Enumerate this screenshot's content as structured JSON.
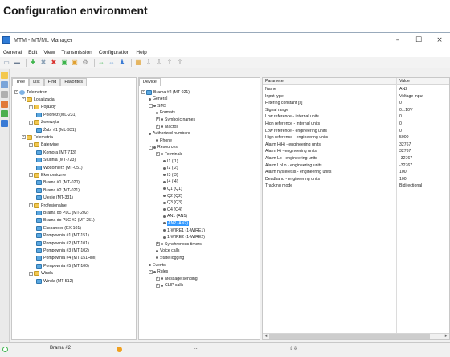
{
  "heading": "Configuration environment",
  "window": {
    "title": "MTM - MT/ML Manager",
    "controls": {
      "minimize": "–",
      "maximize": "☐",
      "close": "×"
    }
  },
  "menu": [
    "General",
    "Edit",
    "View",
    "Transmission",
    "Configuration",
    "Help"
  ],
  "toolbar_icons": [
    "open-icon",
    "save-icon",
    "connect-icon",
    "disconnect-icon",
    "delete-icon",
    "read-icon",
    "write-icon",
    "settings-icon",
    "link-icon",
    "unlink-icon",
    "user-icon",
    "monitor-icon",
    "upload-icon",
    "download-icon",
    "up-icon",
    "top-icon"
  ],
  "left_tabs": [
    "Tree",
    "List",
    "Find",
    "Favorites"
  ],
  "left_tree": [
    {
      "label": "Telemetron",
      "level": 0,
      "icon": "globe",
      "exp": "-"
    },
    {
      "label": "Lokalizacja",
      "level": 1,
      "icon": "folder",
      "exp": "-"
    },
    {
      "label": "Pojazdy",
      "level": 2,
      "icon": "folder",
      "exp": "-"
    },
    {
      "label": "Polonez (ML-231)",
      "level": 3,
      "icon": "dev",
      "exp": ""
    },
    {
      "label": "Zwierzęta",
      "level": 2,
      "icon": "folder",
      "exp": "-"
    },
    {
      "label": "Żubr #1 (ML-931)",
      "level": 3,
      "icon": "dev",
      "exp": ""
    },
    {
      "label": "Telemetria",
      "level": 1,
      "icon": "folder",
      "exp": "-"
    },
    {
      "label": "Bateryjne",
      "level": 2,
      "icon": "folder",
      "exp": "-"
    },
    {
      "label": "Komora (MT-713)",
      "level": 3,
      "icon": "dev",
      "exp": ""
    },
    {
      "label": "Studnia (MT-723)",
      "level": 3,
      "icon": "dev",
      "exp": ""
    },
    {
      "label": "Wodomierz (MT-051)",
      "level": 3,
      "icon": "dev",
      "exp": ""
    },
    {
      "label": "Ekonomiczne",
      "level": 2,
      "icon": "folder",
      "exp": "-"
    },
    {
      "label": "Brama #1 (MT-020)",
      "level": 3,
      "icon": "dev",
      "exp": ""
    },
    {
      "label": "Brama #2 (MT-021)",
      "level": 3,
      "icon": "dev",
      "exp": ""
    },
    {
      "label": "Ujęcie (MT-331)",
      "level": 3,
      "icon": "dev",
      "exp": ""
    },
    {
      "label": "Profesjonalne",
      "level": 2,
      "icon": "folder",
      "exp": "-"
    },
    {
      "label": "Brama do PLC (MT-202)",
      "level": 3,
      "icon": "dev",
      "exp": ""
    },
    {
      "label": "Brama do PLC #2 (MT-251)",
      "level": 3,
      "icon": "dev",
      "exp": ""
    },
    {
      "label": "Ekspander (EX-101)",
      "level": 3,
      "icon": "dev",
      "exp": ""
    },
    {
      "label": "Pompownia #1 (MT-151)",
      "level": 3,
      "icon": "dev",
      "exp": ""
    },
    {
      "label": "Pompownia #2 (MT-101)",
      "level": 3,
      "icon": "dev",
      "exp": ""
    },
    {
      "label": "Pompownia #3 (MT-102)",
      "level": 3,
      "icon": "dev",
      "exp": ""
    },
    {
      "label": "Pompownia #4 (MT-151HMI)",
      "level": 3,
      "icon": "dev",
      "exp": ""
    },
    {
      "label": "Pompownia #5 (MT-100)",
      "level": 3,
      "icon": "dev",
      "exp": ""
    },
    {
      "label": "Winda",
      "level": 2,
      "icon": "folder",
      "exp": "-"
    },
    {
      "label": "Winda (MT-512)",
      "level": 3,
      "icon": "dev",
      "exp": ""
    }
  ],
  "device_tab": "Device",
  "device_tree": [
    {
      "label": "Brama #2 (MT-021)",
      "level": 0,
      "icon": "dev",
      "exp": "-"
    },
    {
      "label": "General",
      "level": 1,
      "icon": "dot",
      "exp": ""
    },
    {
      "label": "SMS",
      "level": 1,
      "icon": "dot",
      "exp": "-"
    },
    {
      "label": "Formats",
      "level": 2,
      "icon": "dot",
      "exp": ""
    },
    {
      "label": "Symbolic names",
      "level": 2,
      "icon": "dot",
      "exp": "+"
    },
    {
      "label": "Macros",
      "level": 2,
      "icon": "dot",
      "exp": "+"
    },
    {
      "label": "Authorized numbers",
      "level": 1,
      "icon": "dot",
      "exp": ""
    },
    {
      "label": "Phone",
      "level": 2,
      "icon": "dot",
      "exp": ""
    },
    {
      "label": "Resources",
      "level": 1,
      "icon": "dot",
      "exp": "-"
    },
    {
      "label": "Terminals",
      "level": 2,
      "icon": "dot",
      "exp": "-"
    },
    {
      "label": "I1 (I1)",
      "level": 3,
      "icon": "dot",
      "exp": ""
    },
    {
      "label": "I2 (I2)",
      "level": 3,
      "icon": "dot",
      "exp": ""
    },
    {
      "label": "I3 (I3)",
      "level": 3,
      "icon": "dot",
      "exp": ""
    },
    {
      "label": "I4 (I4)",
      "level": 3,
      "icon": "dot",
      "exp": ""
    },
    {
      "label": "Q1 (Q1)",
      "level": 3,
      "icon": "dot",
      "exp": ""
    },
    {
      "label": "Q2 (Q2)",
      "level": 3,
      "icon": "dot",
      "exp": ""
    },
    {
      "label": "Q3 (Q3)",
      "level": 3,
      "icon": "dot",
      "exp": ""
    },
    {
      "label": "Q4 (Q4)",
      "level": 3,
      "icon": "dot",
      "exp": ""
    },
    {
      "label": "AN1 (AN1)",
      "level": 3,
      "icon": "dot",
      "exp": ""
    },
    {
      "label": "AN2 (AN2)",
      "level": 3,
      "icon": "dot",
      "exp": "",
      "selected": true
    },
    {
      "label": "1-WIRE1 (1-WIRE1)",
      "level": 3,
      "icon": "dot",
      "exp": ""
    },
    {
      "label": "1-WIRE2 (1-WIRE2)",
      "level": 3,
      "icon": "dot",
      "exp": ""
    },
    {
      "label": "Synchronous timers",
      "level": 2,
      "icon": "dot",
      "exp": "+"
    },
    {
      "label": "Voice calls",
      "level": 2,
      "icon": "dot",
      "exp": ""
    },
    {
      "label": "State logging",
      "level": 2,
      "icon": "dot",
      "exp": ""
    },
    {
      "label": "Events",
      "level": 1,
      "icon": "dot",
      "exp": ""
    },
    {
      "label": "Rules",
      "level": 1,
      "icon": "dot",
      "exp": "-"
    },
    {
      "label": "Message sending",
      "level": 2,
      "icon": "dot",
      "exp": "+"
    },
    {
      "label": "CLIP calls",
      "level": 2,
      "icon": "dot",
      "exp": "+"
    }
  ],
  "params": {
    "headers": [
      "Parameter",
      "Value"
    ],
    "rows": [
      [
        "Name",
        "AN2"
      ],
      [
        "Input type",
        "Voltage input"
      ],
      [
        "Filtering constant [s]",
        "0"
      ],
      [
        "Signal range",
        "0...10V"
      ],
      [
        "Low reference - internal units",
        "0"
      ],
      [
        "High reference - internal units",
        "0"
      ],
      [
        "Low reference - engineering units",
        "0"
      ],
      [
        "High reference - engineering units",
        "5000"
      ],
      [
        "Alarm HiHi - engineering units",
        "32767"
      ],
      [
        "Alarm Hi - engineering units",
        "32767"
      ],
      [
        "Alarm Lo - engineering units",
        "-32767"
      ],
      [
        "Alarm LoLo - engineering units",
        "-32767"
      ],
      [
        "Alarm hysteresis - engineering units",
        "100"
      ],
      [
        "Deadband - engineering units",
        "100"
      ],
      [
        "Tracking mode",
        "Bidirectional"
      ]
    ]
  },
  "status": {
    "device": "Brama #2",
    "placeholder": "...",
    "arrows": "⇧⇩"
  },
  "colors": {
    "selection": "#3399ff",
    "status_orange": "#f0a020",
    "status_green": "#3cb44b"
  }
}
